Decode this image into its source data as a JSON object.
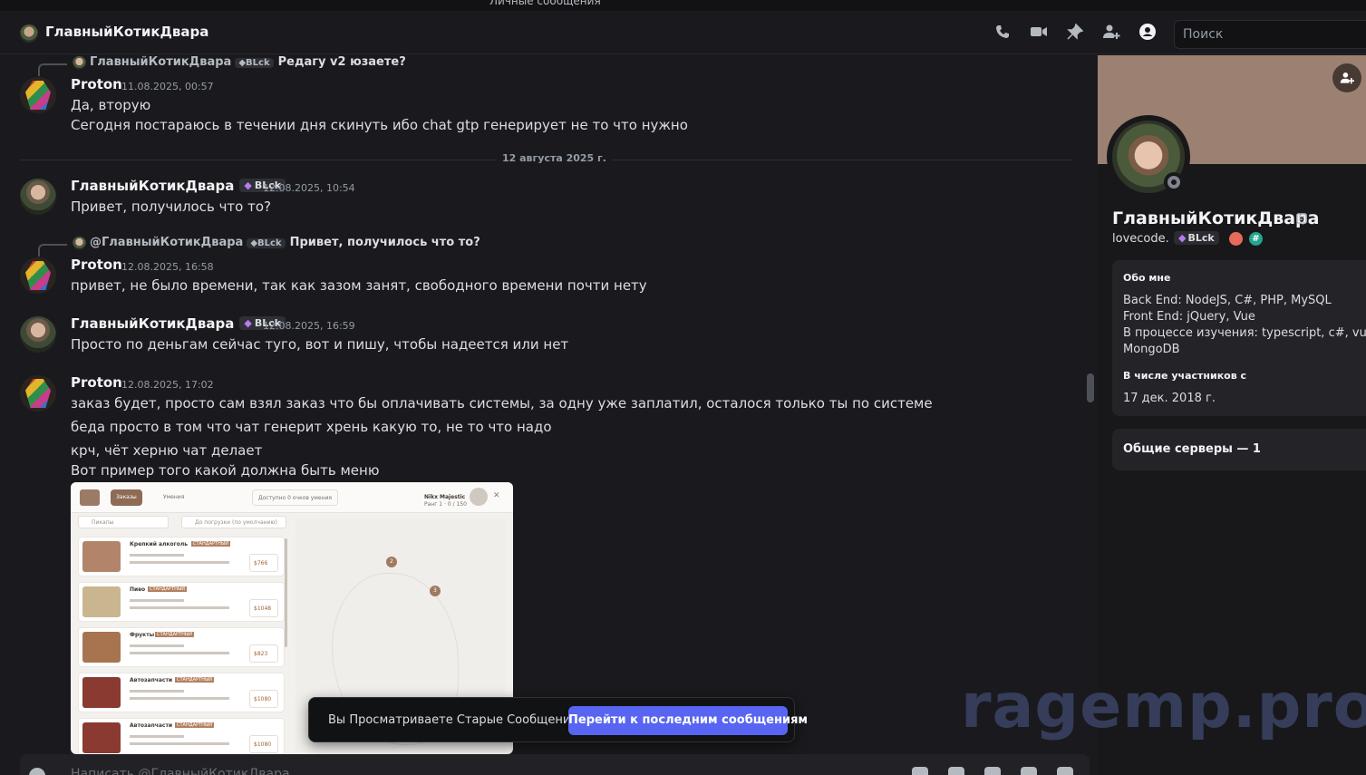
{
  "top_strip": {
    "text": "Личные сообщения"
  },
  "header": {
    "title": "ГлавныйКотикДвара",
    "search_placeholder": "Поиск",
    "icons": [
      "phone-icon",
      "video-icon",
      "pin-icon",
      "add-member-icon",
      "user-profile-icon"
    ]
  },
  "messages": [
    {
      "reply": {
        "name": "ГлавныйКотикДвара",
        "tag": "BLck",
        "text": "Редагу v2 юзаете?"
      },
      "author": "Proton",
      "time": "11.08.2025, 00:57",
      "lines": [
        "Да, вторую",
        "Сегодня постараюсь в течении дня скинуть ибо chat gtp генерирует не то что нужно"
      ]
    },
    {
      "divider": "12 августа 2025 г."
    },
    {
      "author": "ГлавныйКотикДвара",
      "tag": "BLck",
      "time": "12.08.2025, 10:54",
      "lines": [
        "Привет, получилось что то?"
      ]
    },
    {
      "reply": {
        "name": "@ГлавныйКотикДвара",
        "tag": "BLck",
        "text": "Привет, получилось что то?"
      },
      "author": "Proton",
      "time": "12.08.2025, 16:58",
      "lines": [
        "привет,  не было времени, так как зазом занят, свободного времени почти  нету"
      ]
    },
    {
      "author": "ГлавныйКотикДвара",
      "tag": "BLck",
      "time": "12.08.2025, 16:59",
      "lines": [
        "Просто по деньгам сейчас туго, вот и пишу, чтобы надеется или нет"
      ]
    },
    {
      "author": "Proton",
      "time": "12.08.2025, 17:02",
      "lines": [
        "заказ будет, просто сам взял заказ что бы оплачивать системы, за одну уже заплатил, осталося только ты по системе",
        "беда просто в том что чат генерит хрень какую то, не то что надо",
        "крч, чёт херню чат делает",
        "Вот пример того какой должна быть меню"
      ]
    }
  ],
  "attachment": {
    "tab_active": "Заказы",
    "tab_2": "Умения",
    "tab_3": "Доступно 0 очков умения",
    "player": "Nikx Majestic",
    "player_sub": "Ранг 1 · 0 / 150",
    "filter_1": "Пикапы",
    "filter_2": "До погрузки (по умолчанию)",
    "items": [
      {
        "name": "Крепкий алкоголь",
        "badge": "СТАНДАРТНЫЙ",
        "price": "$766"
      },
      {
        "name": "Пиво",
        "badge": "СТАНДАРТНЫЙ",
        "price": "$1048"
      },
      {
        "name": "Фрукты",
        "badge": "СТАНДАРТНЫЙ",
        "price": "$823"
      },
      {
        "name": "Автозапчасти",
        "badge": "СТАНДАРТНЫЙ",
        "price": "$1080"
      },
      {
        "name": "Автозапчасти",
        "badge": "СТАНДАРТНЫЙ",
        "price": "$1080"
      }
    ],
    "map_pins": [
      "2",
      "3"
    ]
  },
  "toast": {
    "label": "Вы Просматриваете Старые Сообщения",
    "button": "Перейти к последним сообщениям"
  },
  "composer": {
    "placeholder": "Написать @ГлавныйКотикДвара"
  },
  "profile": {
    "name": "ГлавныйКотикДвара",
    "username": "lovecode.",
    "tag": "BLck",
    "about_title": "Обо мне",
    "about_lines": [
      "Back End: NodeJS, C#, PHP, MySQL",
      "Front End: jQuery, Vue",
      "В процессе изучения: typescript, c#, vue,",
      "MongoDB"
    ],
    "member_since_title": "В числе участников с",
    "member_since": "17 дек. 2018 г.",
    "mutual_servers": "Общие серверы — 1"
  },
  "watermark": "ragemp.pro",
  "colors": {
    "accent": "#5865f2",
    "bg": "#1a1a1e",
    "panel": "#18181b"
  }
}
